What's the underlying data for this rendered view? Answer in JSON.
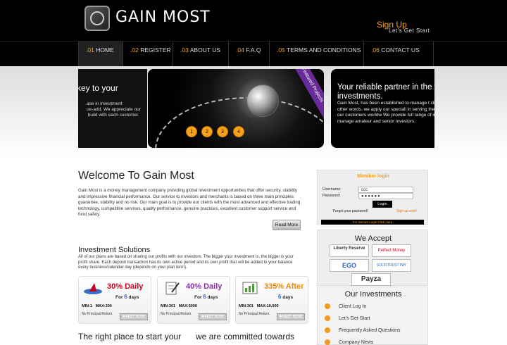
{
  "header": {
    "logo_text": "GAIN MOST",
    "signup": "Sign Up",
    "signup_sub": "Let's Get Start"
  },
  "nav": [
    {
      "num": ".01",
      "label": "HOME"
    },
    {
      "num": ".02",
      "label": "REGISTER"
    },
    {
      "num": ".03",
      "label": "ABOUT US"
    },
    {
      "num": ".04",
      "label": "F.A.Q"
    },
    {
      "num": ".05",
      "label": "TERMS AND CONDITIONS"
    },
    {
      "num": ".06",
      "label": "CONTACT US"
    }
  ],
  "slider": {
    "left_title": "key to your",
    "left_text": "ase in investment\nue-add. We appreciate our\n build with each customer.",
    "ribbon": "Featured Projects",
    "dots": [
      "1",
      "2",
      "3",
      "4"
    ],
    "right_title": "Your reliable partner in the wo investments.",
    "right_text": "Gain Most, has been established to manage t clients. In other words, we apply our speciali in serving the needs of our customers worldw We provide full range of investment manage amateur and senior investors."
  },
  "welcome": {
    "title": "Welcome To Gain Most",
    "text": "Gain Most is a money management company providing global investment opportunities that offer security, stability and impressive financial performance. Our service to investors and merchants is based on three main principles: guarantee, stability and no risk. Our main goal is to provide our clients with the most advanced and effective trading technology, competitive services, quality performance, genuine practices, excellent customer support service and fund safety.",
    "read_more": "Read More"
  },
  "investment": {
    "title": "Investment Solutions",
    "text": "All of our plans are based on sharing our profits with our investors. The bigger your investment is, the bigger is your profit share. Each deposit transaction has its own active period and its own profit that will be added to your balance every business/calendar day (depends on your plan term)."
  },
  "plans": [
    {
      "pct": "30% Daily",
      "for": "For ",
      "days_num": "6",
      "days": " days",
      "min": "MIN:1",
      "max": "MAX:300",
      "npr": "No Principal Return",
      "btn": "INVEST NOW!",
      "color": "#d0021b"
    },
    {
      "pct": "40% Daily",
      "for": "For ",
      "days_num": "6",
      "days": " days",
      "min": "MIN:301",
      "max": "MAX:5000",
      "npr": "No Principal Return",
      "btn": "INVEST NOW!",
      "color": "#8b2fa8"
    },
    {
      "pct": "335% After",
      "for": "",
      "days_num": "6",
      "days": " days",
      "min": "MIN:301",
      "max": "MAX:10,000",
      "npr": "No Principal Return",
      "btn": "INVEST NOW!",
      "color": "#e8890c"
    }
  ],
  "bottom": {
    "h1": "The right place to start your",
    "h2": "we are committed towards"
  },
  "login": {
    "title": "Member login",
    "username_label": "Username:",
    "username_value": "ccc",
    "password_label": "Password:",
    "password_value": "●●●●●●",
    "login_btn": "Login",
    "forgot": "Forgot your password!",
    "signup": "Sign up now!",
    "secure": "For Secure Login Click Here"
  },
  "accept": {
    "title": "We Accept",
    "methods": [
      "Liberty Reserve",
      "Perfect Money",
      "EGO",
      "SOLIDTRUST PAY",
      "Payza"
    ]
  },
  "our_investments": {
    "title": "Our Investments",
    "items": [
      "Client Log In",
      "Let's Get Start",
      "Frequently Asked Questions",
      "Company News"
    ]
  }
}
